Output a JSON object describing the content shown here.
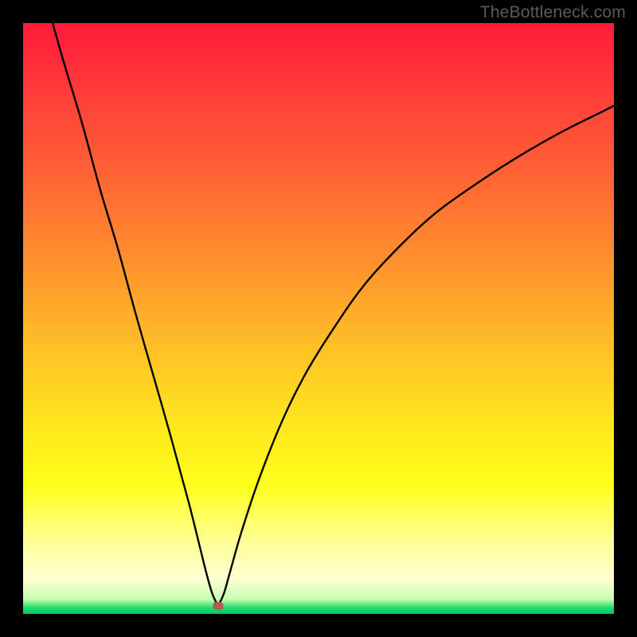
{
  "watermark": "TheBottleneck.com",
  "chart_data": {
    "type": "line",
    "title": "",
    "xlabel": "",
    "ylabel": "",
    "xlim": [
      0,
      100
    ],
    "ylim": [
      0,
      100
    ],
    "grid": false,
    "legend": false,
    "marker": {
      "x": 33,
      "y": 1.3
    },
    "series": [
      {
        "name": "left",
        "x": [
          5,
          7,
          10,
          13,
          16,
          19,
          22,
          25,
          28,
          30,
          31,
          32,
          33
        ],
        "y": [
          100,
          93,
          83,
          72,
          62,
          51,
          40.5,
          30,
          19,
          11,
          7,
          3.5,
          1.3
        ]
      },
      {
        "name": "right",
        "x": [
          33,
          34,
          35,
          37,
          40,
          44,
          48,
          53,
          58,
          64,
          70,
          77,
          84,
          91,
          98,
          100
        ],
        "y": [
          1.3,
          3.5,
          7,
          14,
          23,
          33,
          41,
          49,
          56,
          62.5,
          68,
          73,
          77.5,
          81.5,
          85,
          86
        ]
      }
    ],
    "annotations": []
  }
}
